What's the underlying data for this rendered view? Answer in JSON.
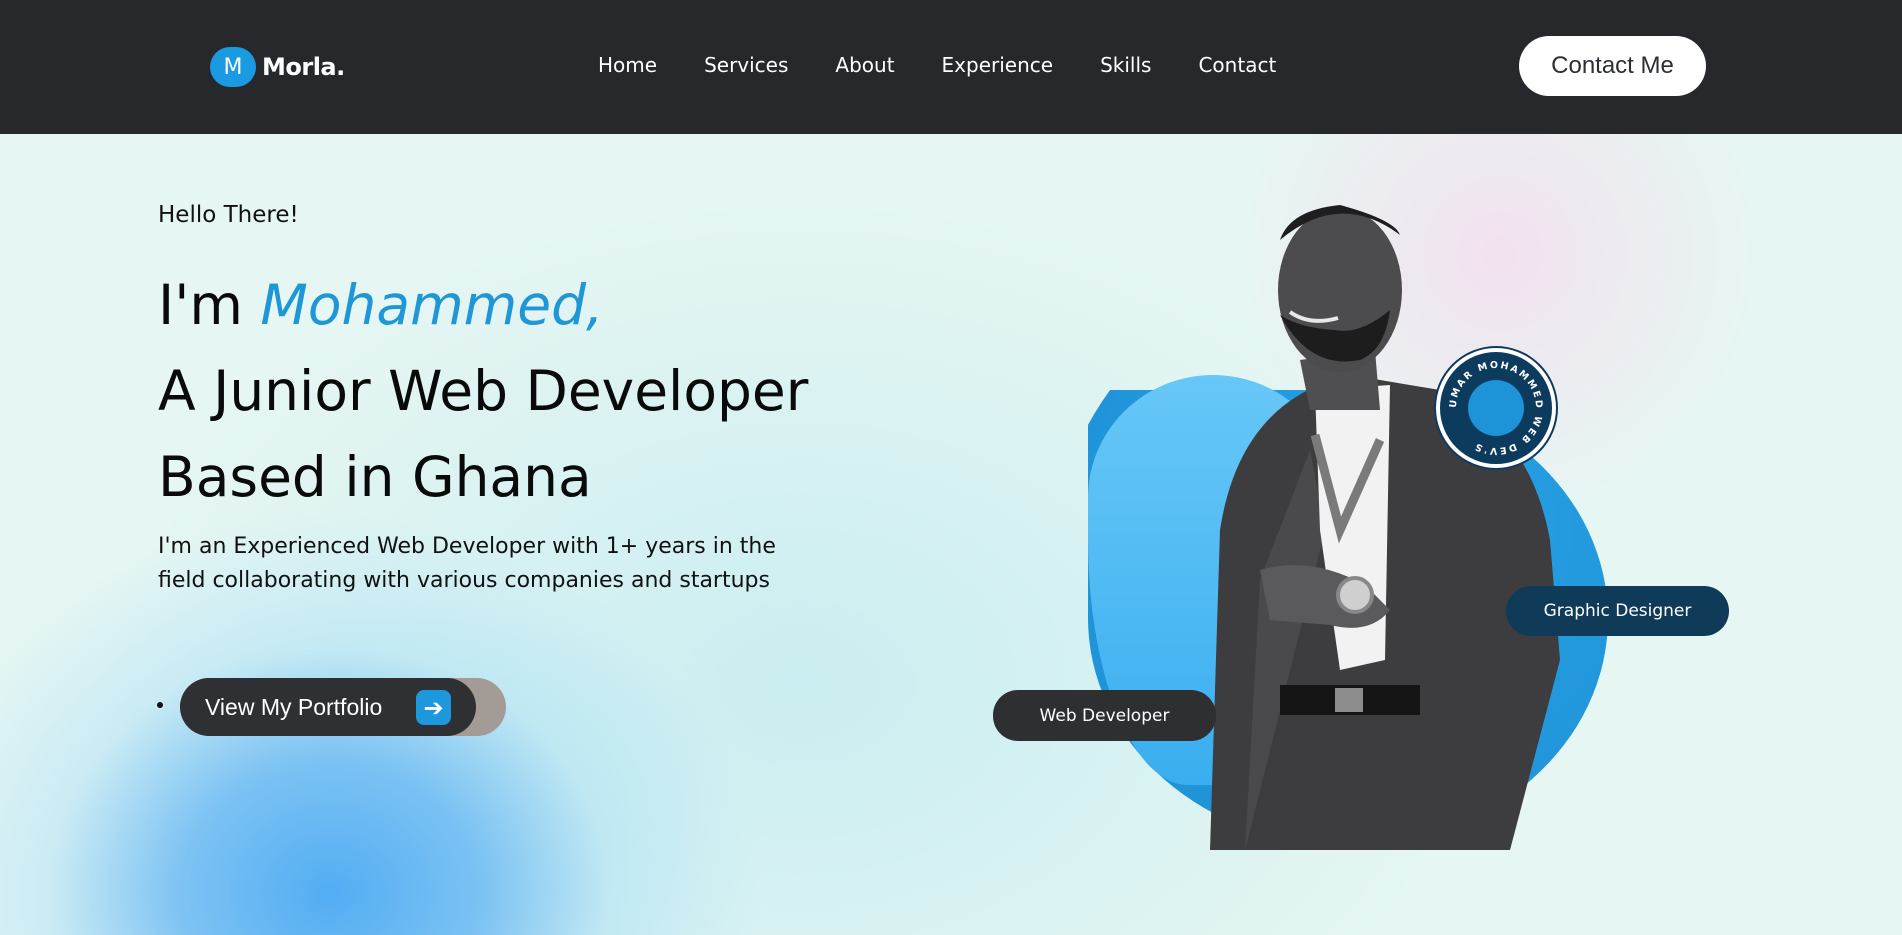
{
  "header": {
    "logo_letter": "M",
    "logo_text": "Morla.",
    "nav": [
      "Home",
      "Services",
      "About",
      "Experience",
      "Skills",
      "Contact"
    ],
    "cta_label": "Contact Me"
  },
  "hero": {
    "greeting": "Hello There!",
    "headline_prefix": "I'm ",
    "headline_name": "Mohammed,",
    "headline_line2": "A Junior Web Developer",
    "headline_line3": "Based in Ghana",
    "intro_line1": "I'm an Experienced Web Developer with 1+ years in the",
    "intro_line2": "field collaborating with various companies and startups",
    "portfolio_label": "View My Portfolio",
    "arrow_glyph": "➔"
  },
  "portrait": {
    "stamp_text": "UMAR MOHAMMED WEB DEV'S",
    "tag_graphic": "Graphic Designer",
    "tag_web": "Web Developer"
  },
  "colors": {
    "accent": "#1f96d6",
    "header_bg": "#26282b",
    "stamp_bg": "#0d3b5e",
    "pill_dark": "#2e2f31"
  },
  "icons": {
    "logo": "logo-mark-icon",
    "portfolio_arrow": "arrow-right-icon",
    "stamp": "circular-badge-icon"
  }
}
